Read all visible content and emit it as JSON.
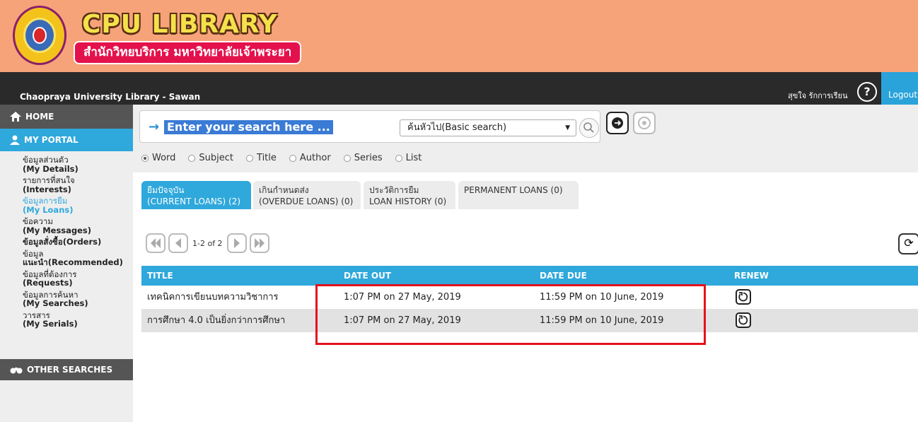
{
  "banner": {
    "title": "CPU LIBRARY",
    "subtitle": "สำนักวิทยบริการ มหาวิทยาลัยเจ้าพระยา",
    "seal_icon": "university-seal-icon"
  },
  "topbar": {
    "site_name": "Chaopraya University Library - Sawan",
    "user_name": "สุขใจ รักการเรียน",
    "help_label": "?",
    "logout_label": "Logout"
  },
  "sidebar": {
    "home": "HOME",
    "portal": "MY PORTAL",
    "items": [
      {
        "th": "ข้อมูลส่วนตัว",
        "en": "(My Details)"
      },
      {
        "th": "รายการที่สนใจ",
        "en": "(Interests)"
      },
      {
        "th": "ข้อมูลการยืม",
        "en": "(My Loans)"
      },
      {
        "th": "ข้อความ",
        "en": "(My Messages)"
      },
      {
        "th": "ข้อมูลสั่งซื้อ(Orders)",
        "en": ""
      },
      {
        "th": "ข้อมูล",
        "en": "แนะนำ(Recommended)"
      },
      {
        "th": "ข้อมูลที่ต้องการ",
        "en": "(Requests)"
      },
      {
        "th": "ข้อมูลการค้นหา",
        "en": "(My Searches)"
      },
      {
        "th": "วารสาร",
        "en": "(My Serials)"
      }
    ],
    "other": "OTHER SEARCHES",
    "active_color": "#2fa8dc"
  },
  "search": {
    "placeholder": "Enter your search here ...",
    "mode": "ค้นหัวไป(Basic search)",
    "options": [
      "Word",
      "Subject",
      "Title",
      "Author",
      "Series",
      "List"
    ],
    "selected": "Word"
  },
  "tabs": [
    {
      "th": "ยืมปัจจุบัน",
      "en": "(CURRENT LOANS) (2)"
    },
    {
      "th": "เกินกำหนดส่ง",
      "en": "(OVERDUE LOANS) (0)"
    },
    {
      "th": "ประวัติการยืม",
      "en": "LOAN HISTORY (0)"
    },
    {
      "th": "PERMANENT LOANS (0)",
      "en": ""
    }
  ],
  "pager": {
    "text": "1-2 of 2"
  },
  "table": {
    "headers": [
      "TITLE",
      "DATE OUT",
      "DATE DUE",
      "RENEW"
    ],
    "rows": [
      {
        "title": "เทคนิคการเขียนบทความวิชาการ",
        "date_out": "1:07 PM on 27 May, 2019",
        "date_due": "11:59 PM on 10 June, 2019"
      },
      {
        "title": "การศึกษา 4.0 เป็นยิ่งกว่าการศึกษา",
        "date_out": "1:07 PM on 27 May, 2019",
        "date_due": "11:59 PM on 10 June, 2019"
      }
    ]
  },
  "colors": {
    "accent": "#2fa8dc",
    "banner": "#f6a37a",
    "highlight": "#e3121f"
  }
}
